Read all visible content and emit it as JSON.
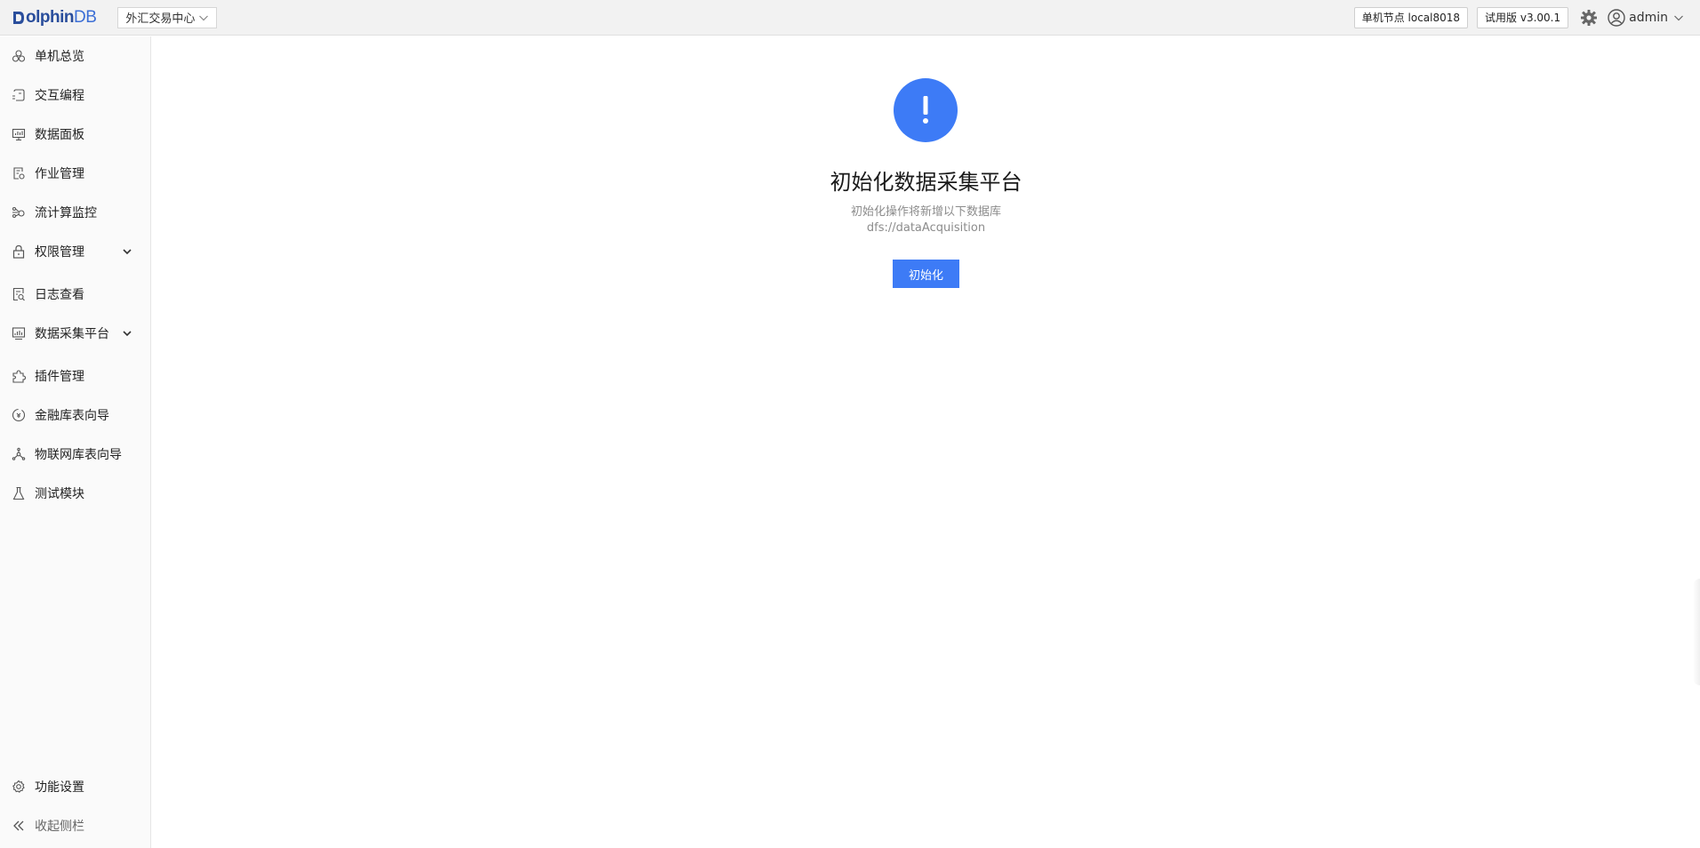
{
  "header": {
    "logo_text": "olphin",
    "logo_db": "DB",
    "cluster_select": "外汇交易中心",
    "node_badge": "单机节点 local8018",
    "version_badge": "试用版 v3.00.1",
    "user": "admin"
  },
  "sidebar": {
    "items": [
      {
        "label": "单机总览",
        "icon": "overview-icon"
      },
      {
        "label": "交互编程",
        "icon": "shell-icon"
      },
      {
        "label": "数据面板",
        "icon": "dashboard-icon"
      },
      {
        "label": "作业管理",
        "icon": "job-icon"
      },
      {
        "label": "流计算监控",
        "icon": "stream-icon"
      },
      {
        "label": "权限管理",
        "icon": "lock-icon"
      },
      {
        "label": "日志查看",
        "icon": "log-icon"
      },
      {
        "label": "数据采集平台",
        "icon": "collect-icon"
      },
      {
        "label": "插件管理",
        "icon": "plugin-icon"
      },
      {
        "label": "金融库表向导",
        "icon": "finance-icon"
      },
      {
        "label": "物联网库表向导",
        "icon": "iot-icon"
      },
      {
        "label": "测试模块",
        "icon": "flask-icon"
      }
    ],
    "settings_label": "功能设置",
    "collapse_label": "收起侧栏"
  },
  "main": {
    "title": "初始化数据采集平台",
    "subtitle_line1": "初始化操作将新增以下数据库",
    "subtitle_line2": "dfs://dataAcquisition",
    "init_button": "初始化"
  },
  "colors": {
    "accent": "#3d7bf6",
    "logo": "#2a4e9c"
  }
}
